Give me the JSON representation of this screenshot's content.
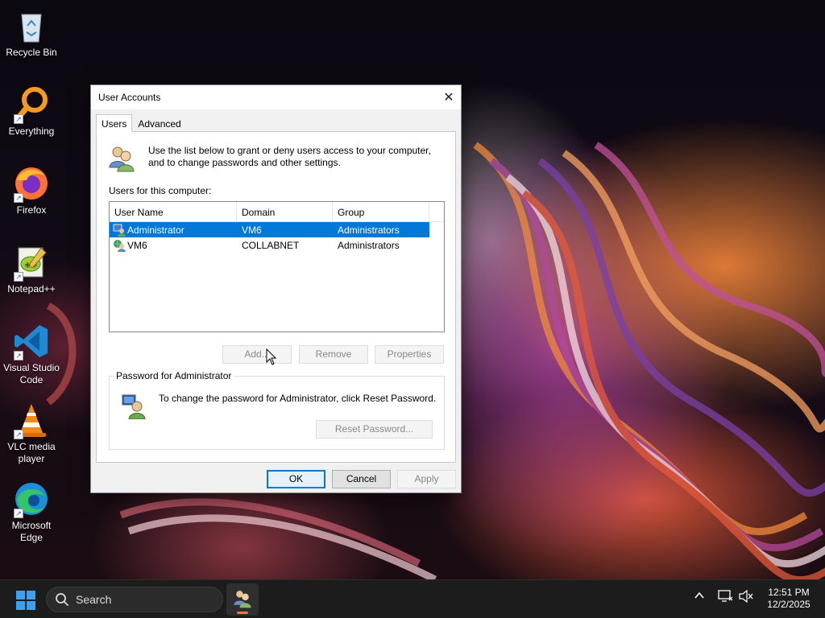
{
  "desktop": {
    "icons": [
      {
        "label": "Recycle Bin",
        "icon": "recycle-bin-icon"
      },
      {
        "label": "Everything",
        "icon": "everything-search-icon"
      },
      {
        "label": "Firefox",
        "icon": "firefox-icon"
      },
      {
        "label": "Notepad++",
        "icon": "notepad-plus-plus-icon"
      },
      {
        "label": "Visual Studio Code",
        "icon": "vscode-icon"
      },
      {
        "label": "VLC media player",
        "icon": "vlc-icon"
      },
      {
        "label": "Microsoft Edge",
        "icon": "edge-icon"
      }
    ]
  },
  "dialog": {
    "title": "User Accounts",
    "close_label": "✕",
    "tabs": [
      {
        "label": "Users",
        "active": true
      },
      {
        "label": "Advanced",
        "active": false
      }
    ],
    "intro_text": "Use the list below to grant or deny users access to your computer, and to change passwords and other settings.",
    "users_label": "Users for this computer:",
    "columns": [
      "User Name",
      "Domain",
      "Group"
    ],
    "rows": [
      {
        "user": "Administrator",
        "domain": "VM6",
        "group": "Administrators",
        "selected": true
      },
      {
        "user": "VM6",
        "domain": "COLLABNET",
        "group": "Administrators",
        "selected": false
      }
    ],
    "buttons": {
      "add": "Add...",
      "remove": "Remove",
      "properties": "Properties",
      "reset_password": "Reset Password...",
      "ok": "OK",
      "cancel": "Cancel",
      "apply": "Apply"
    },
    "password_group": {
      "legend": "Password for Administrator",
      "text": "To change the password for Administrator, click Reset Password."
    },
    "accent_color": "#0078d7"
  },
  "taskbar": {
    "search_placeholder": "Search",
    "time": "12:51 PM",
    "date": "12/2/2025",
    "accent_color": "#e87a46"
  }
}
